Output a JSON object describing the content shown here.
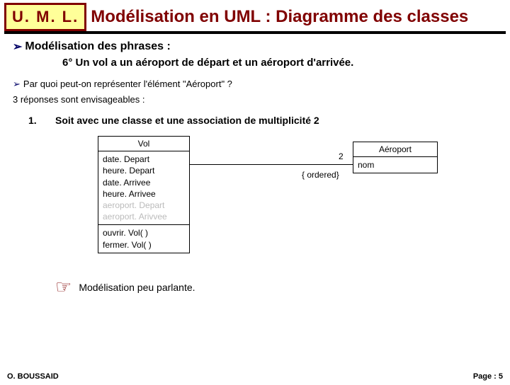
{
  "header": {
    "logo": "U. M. L.",
    "title": "Modélisation en UML : Diagramme des classes"
  },
  "main": {
    "section_label": "Modélisation des phrases :",
    "rule": "6° Un vol a un aéroport de départ et un aéroport d'arrivée.",
    "question": "Par quoi peut-on représenter l'élément \"Aéroport\" ?",
    "answers_intro": "3 réponses sont envisageables :",
    "option_num": "1.",
    "option_text": "Soit avec une classe et une association de multiplicité 2",
    "note": "Modélisation peu parlante."
  },
  "diagram": {
    "vol": {
      "name": "Vol",
      "attrs": [
        "date. Depart",
        "heure. Depart",
        "date. Arrivee",
        "heure. Arrivee"
      ],
      "crossed": [
        "aeroport. Depart",
        "aeroport. Arivvee"
      ],
      "ops": [
        "ouvrir. Vol( )",
        "fermer. Vol( )"
      ]
    },
    "aero": {
      "name": "Aéroport",
      "attrs": [
        "nom"
      ]
    },
    "multiplicity": "2",
    "constraint": "{ ordered}"
  },
  "footer": {
    "author": "O. BOUSSAID",
    "page": "Page : 5"
  }
}
